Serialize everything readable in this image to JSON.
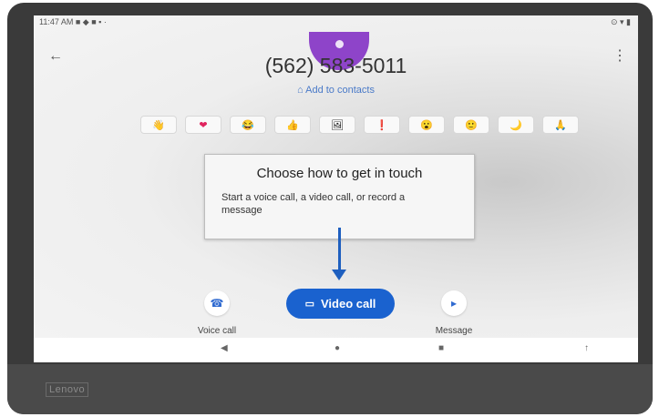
{
  "status_bar": {
    "time": "11:47 AM",
    "icons_left": "■ ◆ ■ ▪ ·",
    "icons_right": "⊙ ▾ ▮"
  },
  "header": {
    "phone_number": "(562) 583-5011",
    "add_to_contacts": "Add to contacts",
    "back_icon": "←",
    "menu_icon": "⋮"
  },
  "reactions": [
    "👋",
    "❤",
    "😂",
    "👍",
    "🖼",
    "❗",
    "😮",
    "🙂",
    "🌙",
    "🙏"
  ],
  "tooltip": {
    "title": "Choose how to get in touch",
    "body": "Start a voice call, a video call, or record a message"
  },
  "actions": {
    "voice_call_label": "Voice call",
    "video_call_label": "Video call",
    "message_label": "Message",
    "voice_icon": "☎",
    "video_icon": "▭",
    "message_icon": "▸"
  },
  "navbar": {
    "back": "◀",
    "home": "●",
    "recents": "■",
    "extra": "↑"
  },
  "device": {
    "brand": "Lenovo"
  },
  "colors": {
    "accent": "#1a62cf",
    "avatar": "#8e44c9",
    "arrow": "#1e5fbf"
  }
}
